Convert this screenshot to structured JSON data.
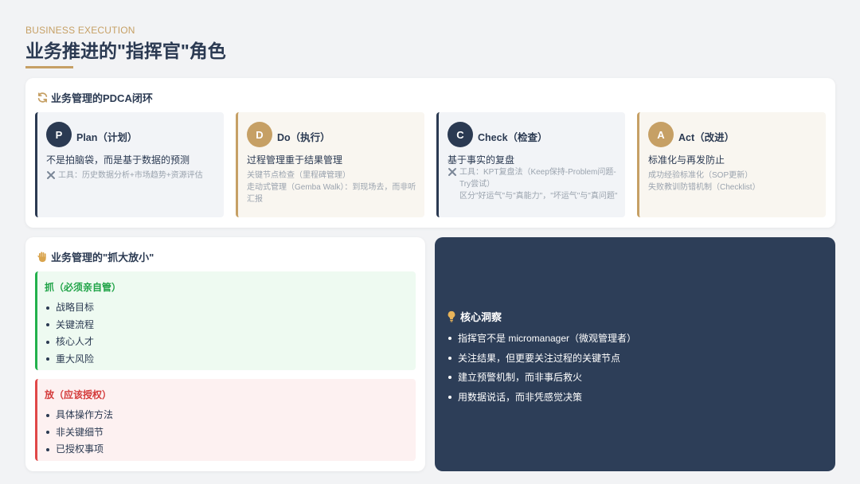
{
  "header": {
    "eyebrow": "BUSINESS EXECUTION",
    "title": "业务推进的\"指挥官\"角色"
  },
  "pdca": {
    "title": "业务管理的PDCA闭环",
    "icon": "refresh-icon",
    "items": [
      {
        "letter": "P",
        "name": "Plan（计划）",
        "desc": "不是拍脑袋，而是基于数据的预测",
        "lines": [
          "工具：历史数据分析+市场趋势+资源评估"
        ],
        "tool": true
      },
      {
        "letter": "D",
        "name": "Do（执行）",
        "desc": "过程管理重于结果管理",
        "lines": [
          "关键节点检查（里程碑管理）",
          "走动式管理（Gemba Walk）：到现场去，而非听汇报"
        ],
        "tool": false
      },
      {
        "letter": "C",
        "name": "Check（检查）",
        "desc": "基于事实的复盘",
        "lines": [
          "工具：KPT复盘法（Keep保持-Problem问题-Try尝试）",
          "区分\"好运气\"与\"真能力\"，\"坏运气\"与\"真问题\""
        ],
        "tool": true
      },
      {
        "letter": "A",
        "name": "Act（改进）",
        "desc": "标准化与再发防止",
        "lines": [
          "成功经验标准化（SOP更新）",
          "失败教训防错机制（Checklist）"
        ],
        "tool": false
      }
    ]
  },
  "grab": {
    "title": "业务管理的\"抓大放小\"",
    "icon": "hand-icon",
    "grab_title": "抓（必须亲自管）",
    "grab_items": [
      "战略目标",
      "关键流程",
      "核心人才",
      "重大风险"
    ],
    "release_title": "放（应该授权）",
    "release_items": [
      "具体操作方法",
      "非关键细节",
      "已授权事项"
    ]
  },
  "insight": {
    "title": "核心洞察",
    "icon": "lightbulb-icon",
    "items": [
      "指挥官不是 micromanager（微观管理者）",
      "关注结果，但更要关注过程的关键节点",
      "建立预警机制，而非事后救火",
      "用数据说话，而非凭感觉决策"
    ]
  },
  "colors": {
    "navy": "#2b3a52",
    "gold": "#c6a065",
    "green": "#22b14c",
    "red": "#e04848"
  }
}
